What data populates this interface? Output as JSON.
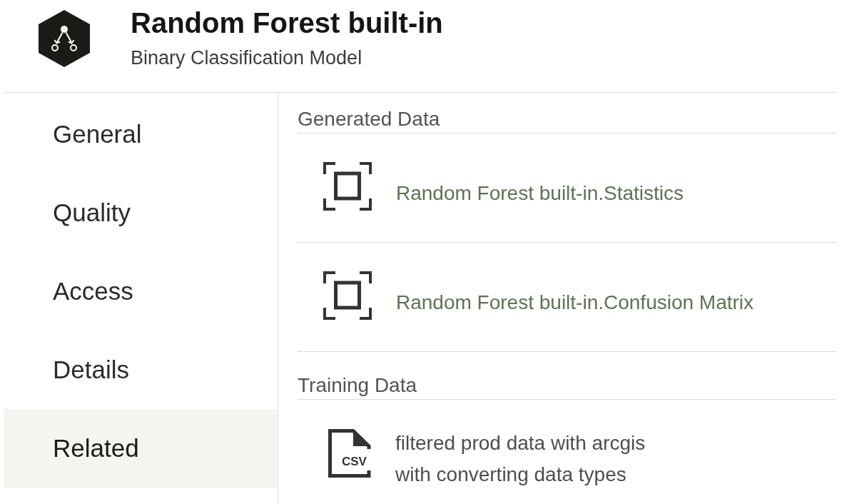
{
  "header": {
    "title": "Random Forest built-in",
    "subtitle": "Binary Classification Model"
  },
  "sidebar": {
    "items": [
      {
        "label": "General",
        "selected": false
      },
      {
        "label": "Quality",
        "selected": false
      },
      {
        "label": "Access",
        "selected": false
      },
      {
        "label": "Details",
        "selected": false
      },
      {
        "label": "Related",
        "selected": true
      }
    ]
  },
  "sections": [
    {
      "heading": "Generated Data",
      "items": [
        {
          "kind": "dataset",
          "label": "Random Forest built-in.Statistics"
        },
        {
          "kind": "dataset",
          "label": "Random Forest built-in.Confusion Matrix"
        }
      ]
    },
    {
      "heading": "Training Data",
      "items": [
        {
          "kind": "csv",
          "icon_text": "CSV",
          "label": "filtered prod data with arcgis with converting data types"
        }
      ]
    }
  ]
}
